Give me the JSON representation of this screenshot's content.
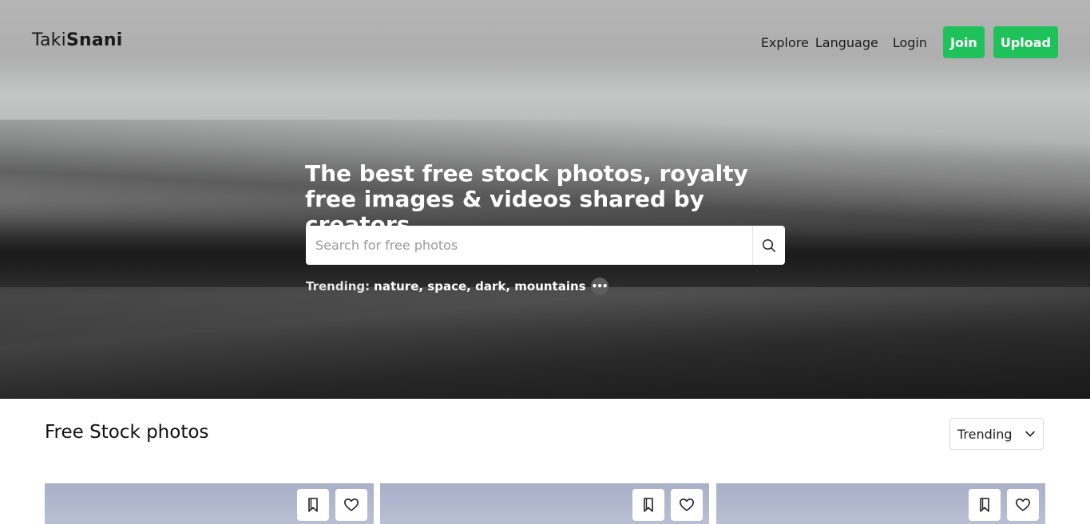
{
  "brand": {
    "logo_prefix": "Taki",
    "logo_bold": "Snani"
  },
  "nav": {
    "explore": "Explore",
    "language": "Language",
    "login": "Login",
    "join": "Join",
    "upload": "Upload"
  },
  "hero": {
    "headline": "The best free stock photos, royalty free images & videos shared by creators.",
    "search_placeholder": "Search for free photos",
    "trending_label": "Trending:",
    "trending_tags": [
      "nature,",
      "space,",
      "dark,",
      "mountains"
    ]
  },
  "section": {
    "title": "Free Stock photos",
    "sort_value": "Trending"
  },
  "icons": {
    "search": "search-icon",
    "more": "more-icon",
    "chevron": "chevron-down-icon",
    "bookmark": "bookmark-icon",
    "heart": "heart-icon"
  },
  "colors": {
    "accent": "#1fc15b",
    "photo_tint": "#b3bad0"
  }
}
